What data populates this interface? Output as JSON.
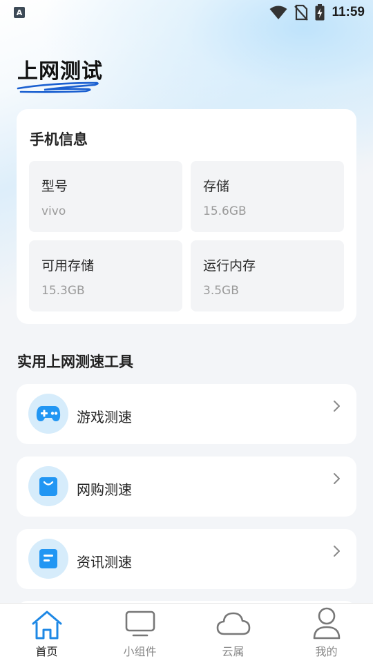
{
  "status_bar": {
    "app_icon_letter": "A",
    "time": "11:59"
  },
  "page": {
    "title": "上网测试"
  },
  "phone_info": {
    "heading": "手机信息",
    "items": [
      {
        "label": "型号",
        "value": "vivo"
      },
      {
        "label": "存储",
        "value": "15.6GB"
      },
      {
        "label": "可用存储",
        "value": "15.3GB"
      },
      {
        "label": "运行内存",
        "value": "3.5GB"
      }
    ]
  },
  "tools": {
    "heading": "实用上网测速工具",
    "items": [
      {
        "label": "游戏测速",
        "icon": "gamepad-icon"
      },
      {
        "label": "网购测速",
        "icon": "shopping-bag-icon"
      },
      {
        "label": "资讯测速",
        "icon": "news-icon"
      }
    ]
  },
  "tabbar": {
    "tabs": [
      {
        "label": "首页",
        "icon": "home-icon",
        "active": true
      },
      {
        "label": "小组件",
        "icon": "monitor-icon",
        "active": false
      },
      {
        "label": "云属",
        "icon": "cloud-icon",
        "active": false
      },
      {
        "label": "我的",
        "icon": "person-icon",
        "active": false
      }
    ]
  },
  "colors": {
    "accent": "#1e88e5",
    "icon_bg": "#d6ecfb",
    "tile_bg": "#f3f4f6",
    "muted_text": "#9a9a9a"
  }
}
